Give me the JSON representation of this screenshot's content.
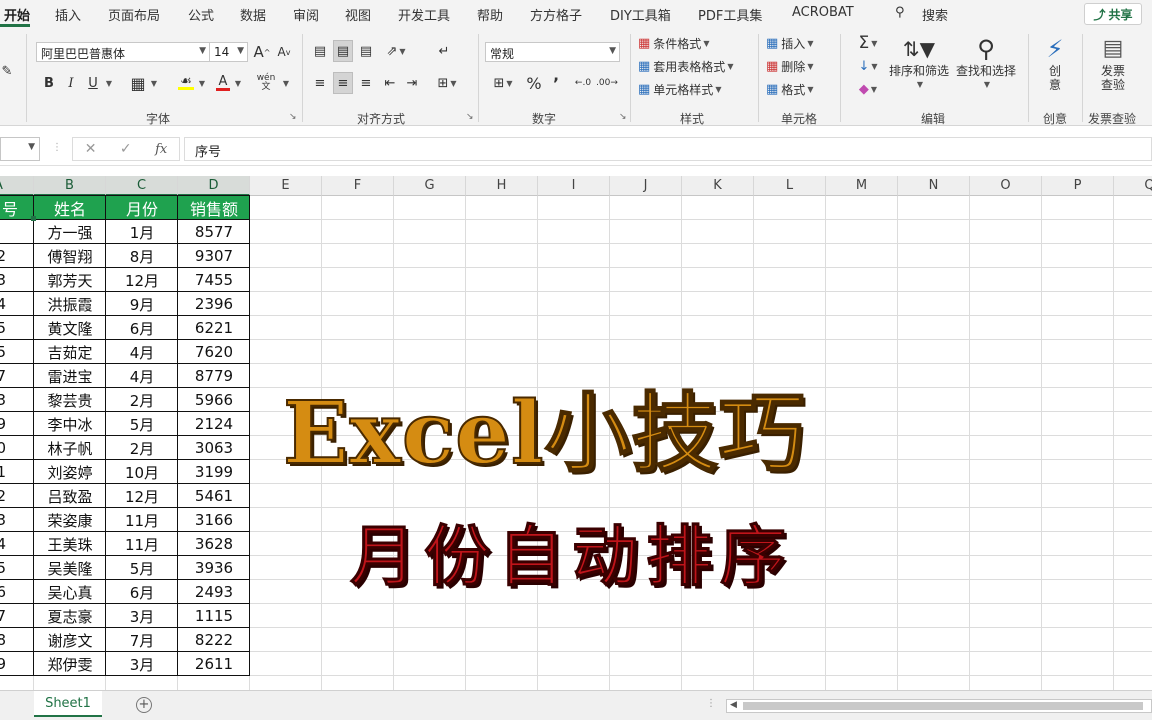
{
  "menu": {
    "tabs": [
      "开始",
      "插入",
      "页面布局",
      "公式",
      "数据",
      "审阅",
      "视图",
      "开发工具",
      "帮助",
      "方方格子",
      "DIY工具箱",
      "PDF工具集",
      "ACROBAT"
    ],
    "search_label": "搜索",
    "share_label": "共享"
  },
  "ribbon": {
    "font": {
      "name": "阿里巴巴普惠体",
      "size": "14",
      "group_label": "字体",
      "bold": "B",
      "italic": "I",
      "underline": "U",
      "grow": "A",
      "shrink": "A",
      "font_color": "A",
      "phonetic": "wén"
    },
    "alignment": {
      "group_label": "对齐方式"
    },
    "number": {
      "format": "常规",
      "group_label": "数字",
      "percent": "%"
    },
    "styles": {
      "conditional": "条件格式",
      "table_format": "套用表格格式",
      "cell_styles": "单元格样式",
      "group_label": "样式"
    },
    "cells": {
      "insert": "插入",
      "delete": "删除",
      "format": "格式",
      "group_label": "单元格"
    },
    "editing": {
      "sort_filter": "排序和筛选",
      "find_select": "查找和选择",
      "group_label": "编辑"
    },
    "create": {
      "label_line1": "创",
      "label_line2": "意",
      "group_label": "创意"
    },
    "invoice": {
      "label_line1": "发票",
      "label_line2": "查验",
      "group_label": "发票查验"
    }
  },
  "formula_bar": {
    "fx": "fx",
    "content": "序号"
  },
  "columns": [
    "A",
    "B",
    "C",
    "D",
    "E",
    "F",
    "G",
    "H",
    "I",
    "J",
    "K",
    "L",
    "M",
    "N",
    "O",
    "P",
    "Q"
  ],
  "table": {
    "headers": [
      "号",
      "姓名",
      "月份",
      "销售额"
    ],
    "rows": [
      [
        "",
        "方一强",
        "1月",
        "8577"
      ],
      [
        "2",
        "傅智翔",
        "8月",
        "9307"
      ],
      [
        "3",
        "郭芳天",
        "12月",
        "7455"
      ],
      [
        "4",
        "洪振霞",
        "9月",
        "2396"
      ],
      [
        "5",
        "黄文隆",
        "6月",
        "6221"
      ],
      [
        "5",
        "吉茹定",
        "4月",
        "7620"
      ],
      [
        "7",
        "雷进宝",
        "4月",
        "8779"
      ],
      [
        "3",
        "黎芸贵",
        "2月",
        "5966"
      ],
      [
        "9",
        "李中冰",
        "5月",
        "2124"
      ],
      [
        "0",
        "林子帆",
        "2月",
        "3063"
      ],
      [
        "1",
        "刘姿婷",
        "10月",
        "3199"
      ],
      [
        "2",
        "吕致盈",
        "12月",
        "5461"
      ],
      [
        "3",
        "荣姿康",
        "11月",
        "3166"
      ],
      [
        "4",
        "王美珠",
        "11月",
        "3628"
      ],
      [
        "5",
        "吴美隆",
        "5月",
        "3936"
      ],
      [
        "6",
        "吴心真",
        "6月",
        "2493"
      ],
      [
        "7",
        "夏志豪",
        "3月",
        "1115"
      ],
      [
        "8",
        "谢彦文",
        "7月",
        "8222"
      ],
      [
        "9",
        "郑伊雯",
        "3月",
        "2611"
      ]
    ]
  },
  "overlay": {
    "title": "Excel小技巧",
    "subtitle": "月份自动排序"
  },
  "sheets": {
    "active": "Sheet1",
    "add": "+"
  },
  "colors": {
    "header_green": "#1fa24f",
    "accent": "#217346",
    "title_orange": "#d58c12",
    "subtitle_red": "#c0141a"
  }
}
